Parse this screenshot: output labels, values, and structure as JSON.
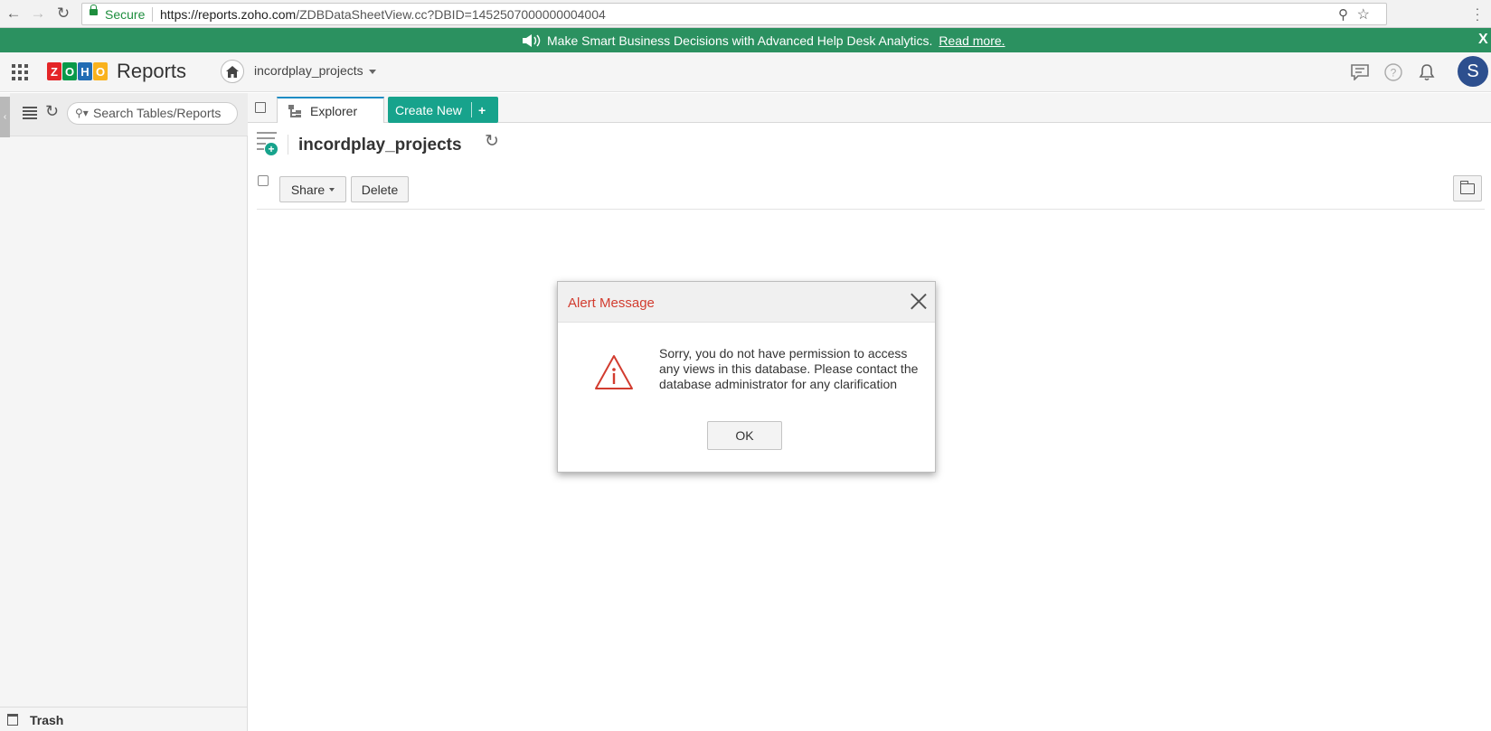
{
  "browser": {
    "secure_label": "Secure",
    "url_host": "https://reports.zoho.com",
    "url_path": "/ZDBDataSheetView.cc?DBID=1452507000000004004"
  },
  "banner": {
    "text": "Make Smart Business Decisions with Advanced Help Desk Analytics.",
    "link": "Read more.",
    "close": "X"
  },
  "header": {
    "logo_letters": [
      "Z",
      "O",
      "H",
      "O"
    ],
    "logo_colors": [
      "#e42527",
      "#089949",
      "#226db4",
      "#f9b21d"
    ],
    "product": "Reports",
    "database": "incordplay_projects",
    "avatar_initial": "S"
  },
  "sidebar": {
    "search_placeholder": "Search Tables/Reports",
    "trash_label": "Trash"
  },
  "tabs": {
    "explorer": "Explorer",
    "create_new": "Create New",
    "create_plus": "+"
  },
  "content": {
    "title": "incordplay_projects",
    "share_label": "Share",
    "delete_label": "Delete"
  },
  "dialog": {
    "title": "Alert Message",
    "message": "Sorry, you do not have permission to access any views in this database. Please contact the database administrator for any clarification",
    "ok_label": "OK"
  },
  "colors": {
    "banner": "#2b9160",
    "accent": "#17a38c",
    "alert_red": "#d23c2f",
    "avatar": "#2d4f8e"
  }
}
